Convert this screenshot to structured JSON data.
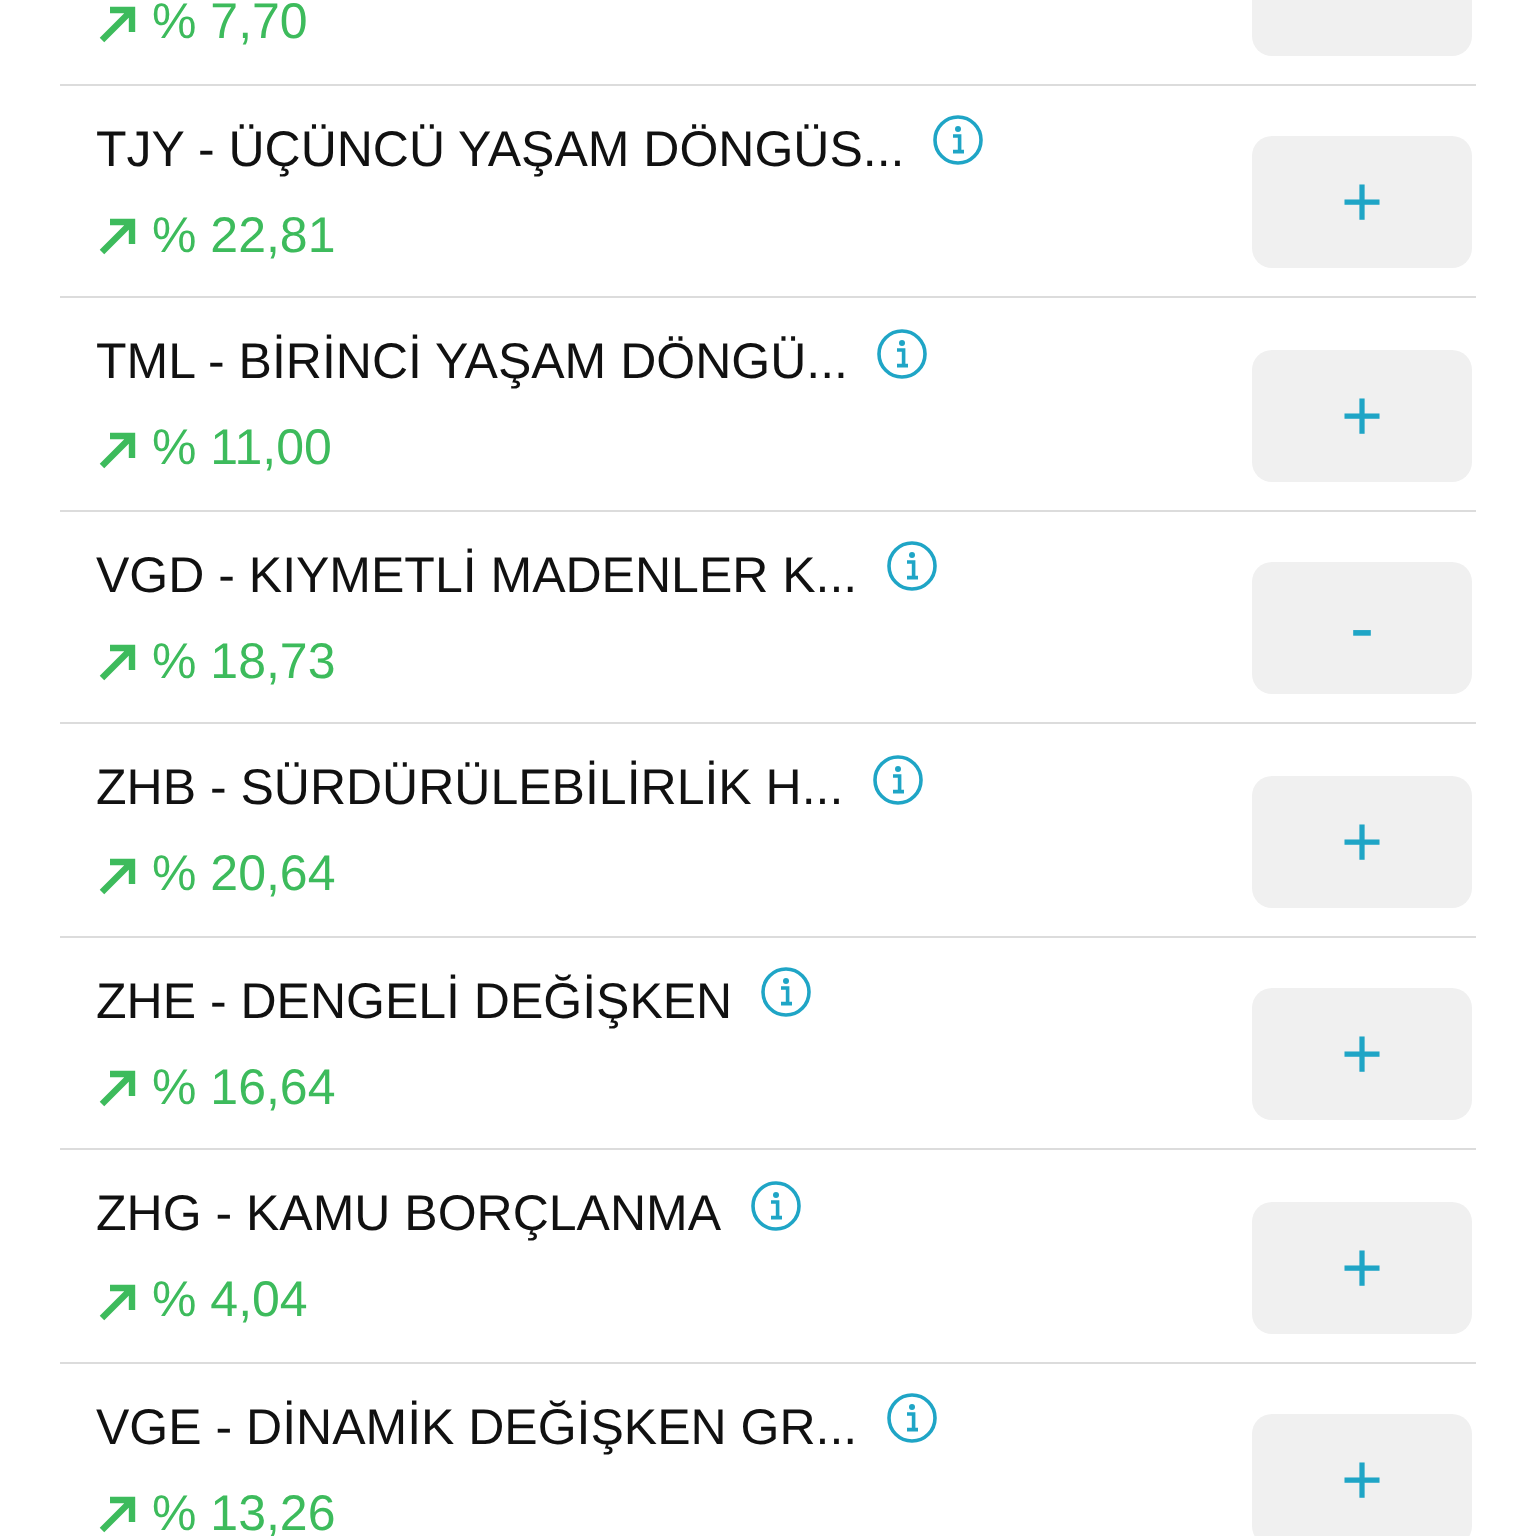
{
  "funds": [
    {
      "return": "% 7,70"
    },
    {
      "name": "TJY - ÜÇÜNCÜ YAŞAM DÖNGÜS...",
      "return": "% 22,81",
      "button": "+"
    },
    {
      "name": "TML - BİRİNCİ YAŞAM DÖNGÜ...",
      "return": "% 11,00",
      "button": "+"
    },
    {
      "name": "VGD - KIYMETLİ MADENLER K...",
      "return": "% 18,73",
      "button": "-"
    },
    {
      "name": "ZHB - SÜRDÜRÜLEBİLİRLİK H...",
      "return": "% 20,64",
      "button": "+"
    },
    {
      "name": "ZHE - DENGELİ DEĞİŞKEN",
      "return": "% 16,64",
      "button": "+"
    },
    {
      "name": "ZHG - KAMU BORÇLANMA",
      "return": "% 4,04",
      "button": "+"
    },
    {
      "name": "VGE - DİNAMİK DEĞİŞKEN GR...",
      "return": "% 13,26",
      "button": "+"
    }
  ]
}
